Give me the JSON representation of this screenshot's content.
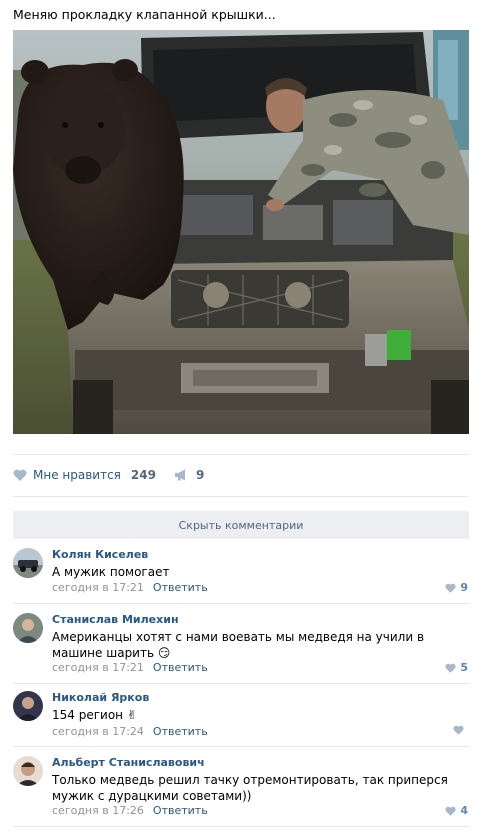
{
  "post": {
    "text": "Меняю прокладку клапанной крышки...",
    "likes_label": "Мне нравится",
    "likes_count": "249",
    "shares_count": "9"
  },
  "comments_toggle": "Скрыть комментарии",
  "comments": [
    {
      "author": "Колян Киселев",
      "text": "А мужик помогает",
      "time": "сегодня в 17:21",
      "reply": "Ответить",
      "likes": "9"
    },
    {
      "author": "Станислав Милехин",
      "text": "Американцы хотят с нами воевать мы медведя на учили в машине шарить",
      "emoji": "😏",
      "time": "сегодня в 17:21",
      "reply": "Ответить",
      "likes": "5"
    },
    {
      "author": "Николай Ярков",
      "text": "154 регион",
      "emoji": "✌",
      "time": "сегодня в 17:24",
      "reply": "Ответить",
      "likes": ""
    },
    {
      "author": "Альберт Станиславович",
      "text": "Только медведь решил тачку отремонтировать, так приперся мужик с дурацкими советами))",
      "time": "сегодня в 17:26",
      "reply": "Ответить",
      "likes": "4"
    }
  ],
  "colors": {
    "link": "#2a5885",
    "meta": "#939393",
    "separator": "#e7e8ec",
    "button_bg": "#eceef1"
  }
}
